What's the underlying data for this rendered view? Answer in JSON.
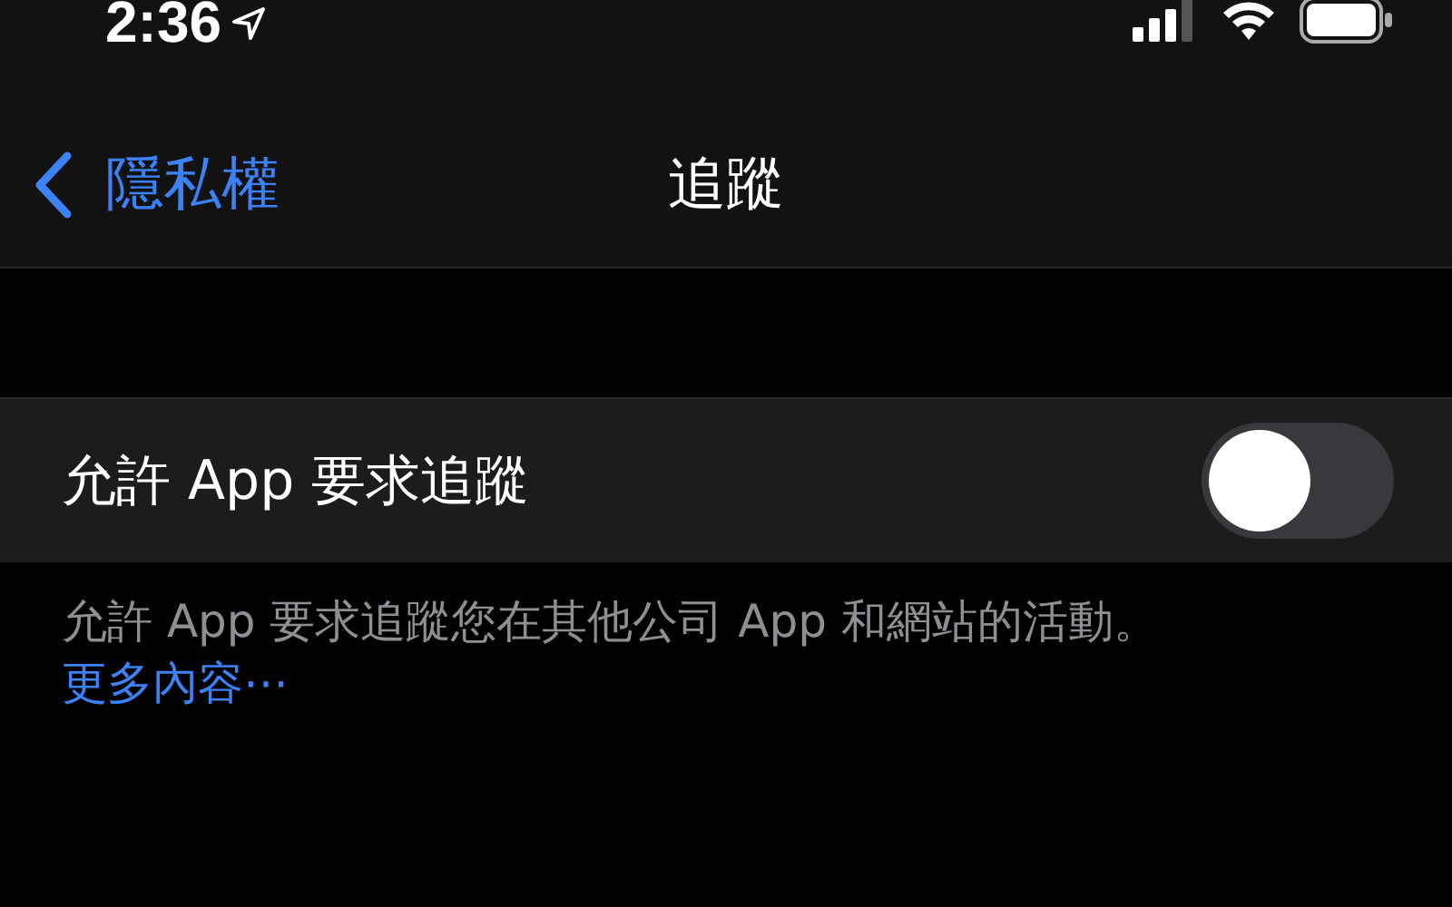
{
  "status_bar": {
    "time": "2:36"
  },
  "nav_bar": {
    "back_label": "隱私權",
    "title": "追蹤"
  },
  "settings": [
    {
      "label": "允許 App 要求追蹤",
      "kind": "toggle",
      "on": false
    }
  ],
  "footer": {
    "text": "允許 App 要求追蹤您在其他公司 App 和網站的活動。",
    "link": "更多內容⋯"
  }
}
